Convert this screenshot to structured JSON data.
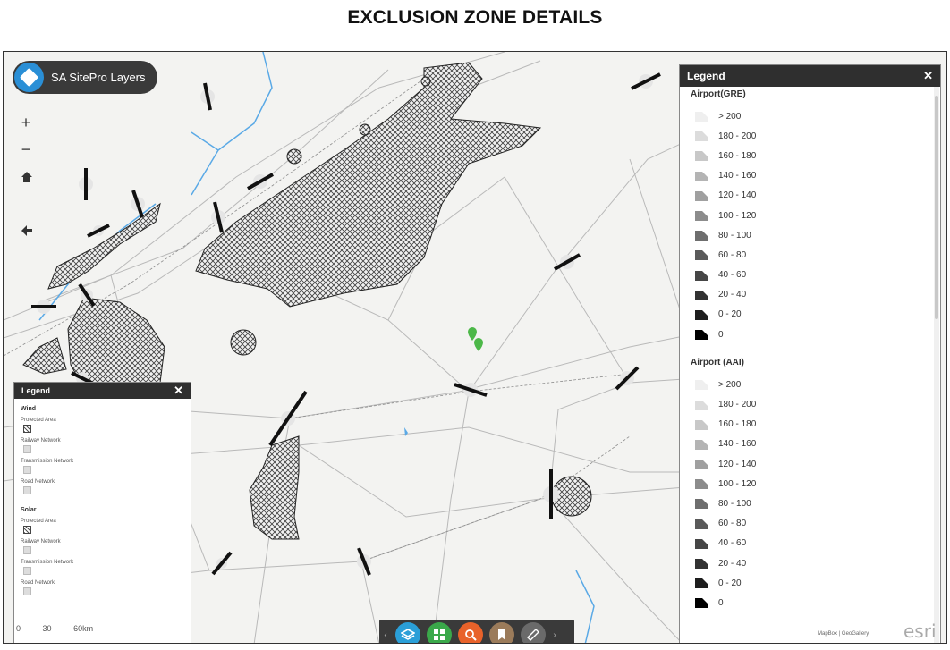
{
  "page": {
    "title": "EXCLUSION ZONE DETAILS"
  },
  "app": {
    "title": "SA SitePro Layers"
  },
  "map_controls": {
    "zoom_in": "+",
    "zoom_out": "−"
  },
  "legend_right": {
    "title": "Legend",
    "close": "✕",
    "sections": [
      {
        "title": "Airport(GRE)",
        "items": [
          "> 200",
          "180 - 200",
          "160 - 180",
          "140 - 160",
          "120 - 140",
          "100 - 120",
          "80 - 100",
          "60 - 80",
          "40 - 60",
          "20 - 40",
          "0 - 20",
          "0"
        ]
      },
      {
        "title": "Airport (AAI)",
        "items": [
          "> 200",
          "180 - 200",
          "160 - 180",
          "140 - 160",
          "120 - 140",
          "100 - 120",
          "80 - 100",
          "60 - 80",
          "40 - 60",
          "20 - 40",
          "0 - 20",
          "0"
        ]
      }
    ]
  },
  "legend_left": {
    "title": "Legend",
    "close": "✕",
    "wind": {
      "title": "Wind",
      "items": [
        "Protected Area",
        "Railway Network",
        "Transmission Network",
        "Road Network"
      ]
    },
    "solar": {
      "title": "Solar",
      "items": [
        "Protected Area",
        "Railway Network",
        "Transmission Network",
        "Road Network"
      ]
    }
  },
  "scale": {
    "labels": [
      "0",
      "30",
      "60km"
    ]
  },
  "toolbar": {
    "prev": "‹",
    "next": "›",
    "buttons": [
      {
        "name": "layers",
        "color": "#2a9fd8"
      },
      {
        "name": "basemap-grid",
        "color": "#3aa84a"
      },
      {
        "name": "search",
        "color": "#e8622a"
      },
      {
        "name": "bookmark",
        "color": "#9b7b5a"
      },
      {
        "name": "measure",
        "color": "#6a6a6a"
      }
    ]
  },
  "attribution": "MapBox | GeoGallery",
  "esri": "esri",
  "colors": {
    "hatch": "#444444",
    "water": "#5aa9e6",
    "marker": "#4cb848",
    "roads": "#b9b9b9"
  }
}
